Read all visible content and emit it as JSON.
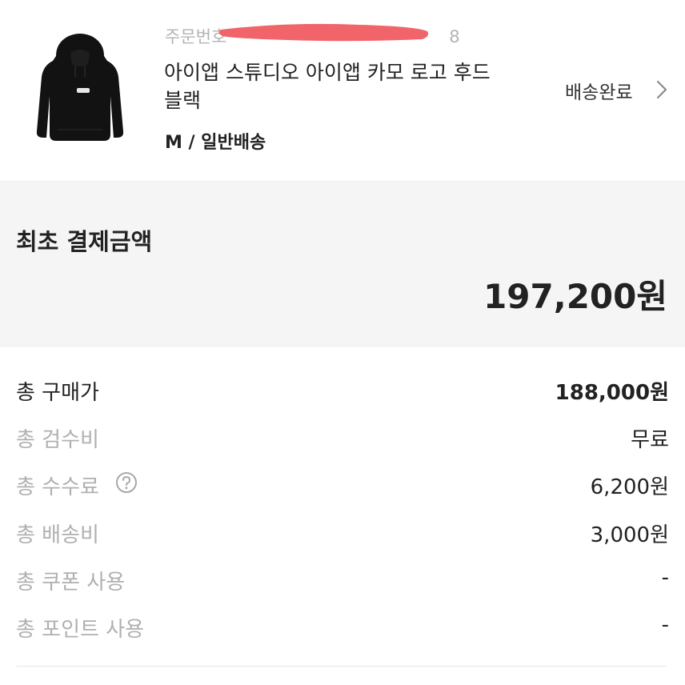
{
  "order": {
    "order_number_label": "주문번호",
    "order_number_tail": "8",
    "product_name": "아이앱 스튜디오 아이앱 카모 로고 후드 블랙",
    "option": "M / 일반배송",
    "status": "배송완료",
    "thumbnail_icon": "black-hoodie-image",
    "status_icon": "chevron-right-icon"
  },
  "payment": {
    "title": "최초 결제금액",
    "amount": "197,200원"
  },
  "breakdown": {
    "rows": [
      {
        "label": "총 구매가",
        "value": "188,000원"
      },
      {
        "label": "총 검수비",
        "value": "무료"
      },
      {
        "label": "총 수수료",
        "value": "6,200원",
        "help_icon": "question-circle-icon"
      },
      {
        "label": "총 배송비",
        "value": "3,000원"
      },
      {
        "label": "총 쿠폰 사용",
        "value": "-"
      },
      {
        "label": "총 포인트 사용",
        "value": "-"
      }
    ]
  },
  "colors": {
    "summary_background": "#f5f5f5",
    "primary_text": "#222222",
    "secondary_text": "#b0b0b0",
    "redaction": "#f0646a"
  }
}
